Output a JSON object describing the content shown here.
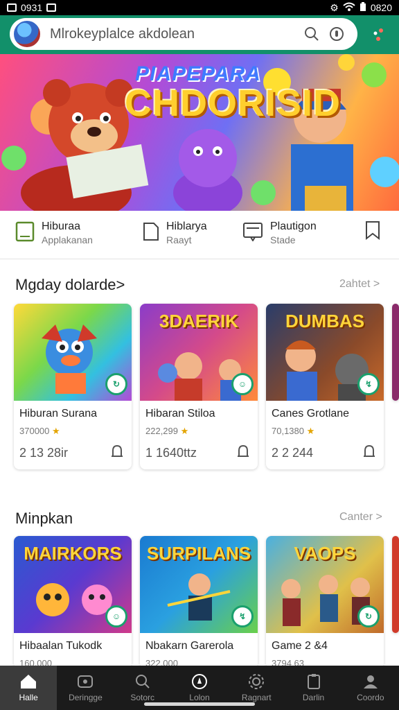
{
  "status": {
    "time": "0931",
    "clock": "0820"
  },
  "search": {
    "text": "Mlrokeyplalce akdolean"
  },
  "hero": {
    "title_top": "PIAPEPARA",
    "title": "CHDORISID"
  },
  "categories": [
    {
      "title": "Hiburaa",
      "subtitle": "Applakanan",
      "icon": "book-icon"
    },
    {
      "title": "Hiblarya",
      "subtitle": "Raayt",
      "icon": "document-icon"
    },
    {
      "title": "Plautigon",
      "subtitle": "Stade",
      "icon": "monitor-icon"
    },
    {
      "icon": "bookmark-icon"
    }
  ],
  "section1": {
    "title": "Mgday dolarde>",
    "link": "2ahtet >",
    "cards": [
      {
        "name": "Hiburan Surana",
        "meta": "370000",
        "size": "2 13 28ir",
        "thumb_title": "",
        "badge": "↻"
      },
      {
        "name": "Hibaran Stiloa",
        "meta": "222,299",
        "size": "1 1640ttz",
        "thumb_title": "3DAERIK",
        "badge": "☺"
      },
      {
        "name": "Canes Grotlane",
        "meta": "70,1380",
        "size": "2 2 244",
        "thumb_title": "DUMBAS",
        "badge": "↯"
      }
    ]
  },
  "section2": {
    "title": "Minpkan",
    "link": "Canter >",
    "cards": [
      {
        "name": "Hibaalan Tukodk",
        "meta": "160,000",
        "thumb_title": "MAIRKORS",
        "badge": "☺"
      },
      {
        "name": "Nbakarn Garerola",
        "meta": "322,000",
        "thumb_title": "SURPILANS",
        "badge": "↯"
      },
      {
        "name": "Game 2 &4",
        "meta": "3794 63",
        "thumb_title": "VAOPS",
        "badge": "↻"
      }
    ]
  },
  "nav": [
    {
      "label": "Halle",
      "icon": "home-icon",
      "active": true
    },
    {
      "label": "Deringge",
      "icon": "folder-icon"
    },
    {
      "label": "Sotorc",
      "icon": "search-icon"
    },
    {
      "label": "Lolon",
      "icon": "compass-icon"
    },
    {
      "label": "Ragnart",
      "icon": "gear-icon"
    },
    {
      "label": "Darlin",
      "icon": "clipboard-icon"
    },
    {
      "label": "Coordo",
      "icon": "user-icon"
    }
  ],
  "colors": {
    "accent": "#12906a",
    "nav_bg": "#1b1b1b",
    "badge": "#1aa06d"
  }
}
